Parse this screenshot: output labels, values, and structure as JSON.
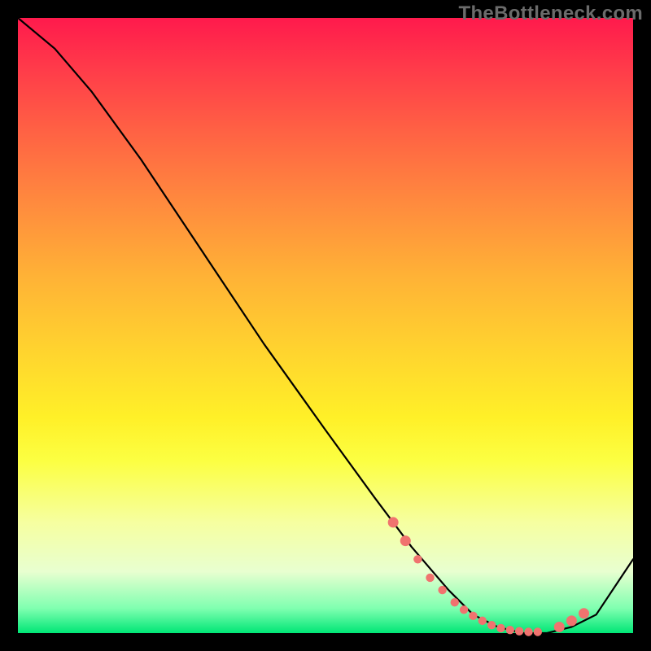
{
  "watermark": "TheBottleneck.com",
  "chart_data": {
    "type": "line",
    "title": "",
    "xlabel": "",
    "ylabel": "",
    "xlim": [
      0,
      100
    ],
    "ylim": [
      0,
      100
    ],
    "series": [
      {
        "name": "bottleneck-curve",
        "x": [
          0,
          6,
          12,
          20,
          30,
          40,
          50,
          58,
          64,
          70,
          74,
          78,
          82,
          86,
          90,
          94,
          100
        ],
        "y": [
          100,
          95,
          88,
          77,
          62,
          47,
          33,
          22,
          14,
          7,
          3,
          1,
          0,
          0,
          1,
          3,
          12
        ]
      }
    ],
    "markers": {
      "name": "highlight-points",
      "x": [
        61,
        63,
        65,
        67,
        69,
        71,
        72.5,
        74,
        75.5,
        77,
        78.5,
        80,
        81.5,
        83,
        84.5,
        88,
        90,
        92
      ],
      "y": [
        18,
        15,
        12,
        9,
        7,
        5,
        3.8,
        2.8,
        2.0,
        1.3,
        0.8,
        0.5,
        0.3,
        0.2,
        0.2,
        1.0,
        2.0,
        3.2
      ]
    }
  }
}
